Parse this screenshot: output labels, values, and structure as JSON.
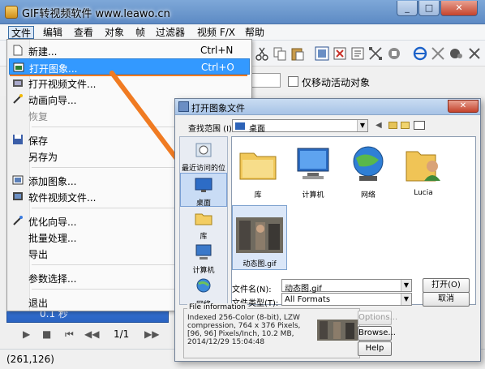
{
  "app": {
    "title": "GIF转视频软件 www.leawo.cn",
    "window_buttons": {
      "minimize": "_",
      "maximize": "□",
      "close": "✕"
    }
  },
  "menubar": [
    "文件",
    "编辑",
    "查看",
    "对象",
    "帧",
    "过滤器",
    "视频 F/X",
    "帮助"
  ],
  "file_menu": [
    {
      "label": "新建...",
      "shortcut": "Ctrl+N",
      "icon": "new-doc-icon"
    },
    {
      "label": "打开图象...",
      "shortcut": "Ctrl+O",
      "icon": "open-image-icon",
      "selected": true
    },
    {
      "label": "打开视频文件...",
      "shortcut": "",
      "icon": "open-video-icon"
    },
    {
      "label": "动画向导...",
      "shortcut": "",
      "icon": "wizard-icon"
    },
    {
      "label": "恢复",
      "shortcut": "",
      "disabled": true
    },
    {
      "label": "保存",
      "shortcut": "",
      "icon": "save-icon"
    },
    {
      "label": "另存为",
      "shortcut": ""
    },
    {
      "label": "添加图象...",
      "shortcut": "",
      "icon": "add-image-icon"
    },
    {
      "label": "软件视频文件...",
      "shortcut": "",
      "icon": "video-file-icon"
    },
    {
      "label": "优化向导...",
      "shortcut": "",
      "icon": "optimize-icon"
    },
    {
      "label": "批量处理...",
      "shortcut": ""
    },
    {
      "label": "导出",
      "shortcut": ""
    },
    {
      "label": "参数选择...",
      "shortcut": ""
    },
    {
      "label": "退出",
      "shortcut": ""
    }
  ],
  "options_row": {
    "checkbox_label": "仅移动活动对象"
  },
  "left_panel": {
    "frame_time": "0.1 秒",
    "frame_counter": "1/1"
  },
  "status_bar": {
    "coords": "(261,126)"
  },
  "dialog": {
    "title": "打开图象文件",
    "look_in_label": "查找范围 (I):",
    "look_in_value": "桌面",
    "places": [
      "最近访问的位置",
      "桌面",
      "库",
      "计算机",
      "网络"
    ],
    "files": [
      {
        "name": "库",
        "icon": "library-icon"
      },
      {
        "name": "计算机",
        "icon": "computer-icon"
      },
      {
        "name": "网络",
        "icon": "network-icon"
      },
      {
        "name": "Lucia",
        "icon": "user-folder-icon"
      },
      {
        "name": "动态图.gif",
        "icon": "gif-thumbnail"
      }
    ],
    "filename_label": "文件名(N):",
    "filename_value": "动态图.gif",
    "filetype_label": "文件类型(T):",
    "filetype_value": "All Formats",
    "open_button": "打开(O)",
    "cancel_button": "取消",
    "file_info_legend": "File information",
    "file_info_text": "Indexed 256-Color (8-bit), LZW compression, 764 x 376 Pixels, [96, 96] Pixels/Inch, 10.2 MB, 2014/12/29 15:04:48",
    "options_button": "Options...",
    "browse_button": "Browse...",
    "help_button": "Help"
  },
  "colors": {
    "accent": "#3399ff",
    "title_bar": "#6f9bd3",
    "arrow": "#f07b22"
  }
}
